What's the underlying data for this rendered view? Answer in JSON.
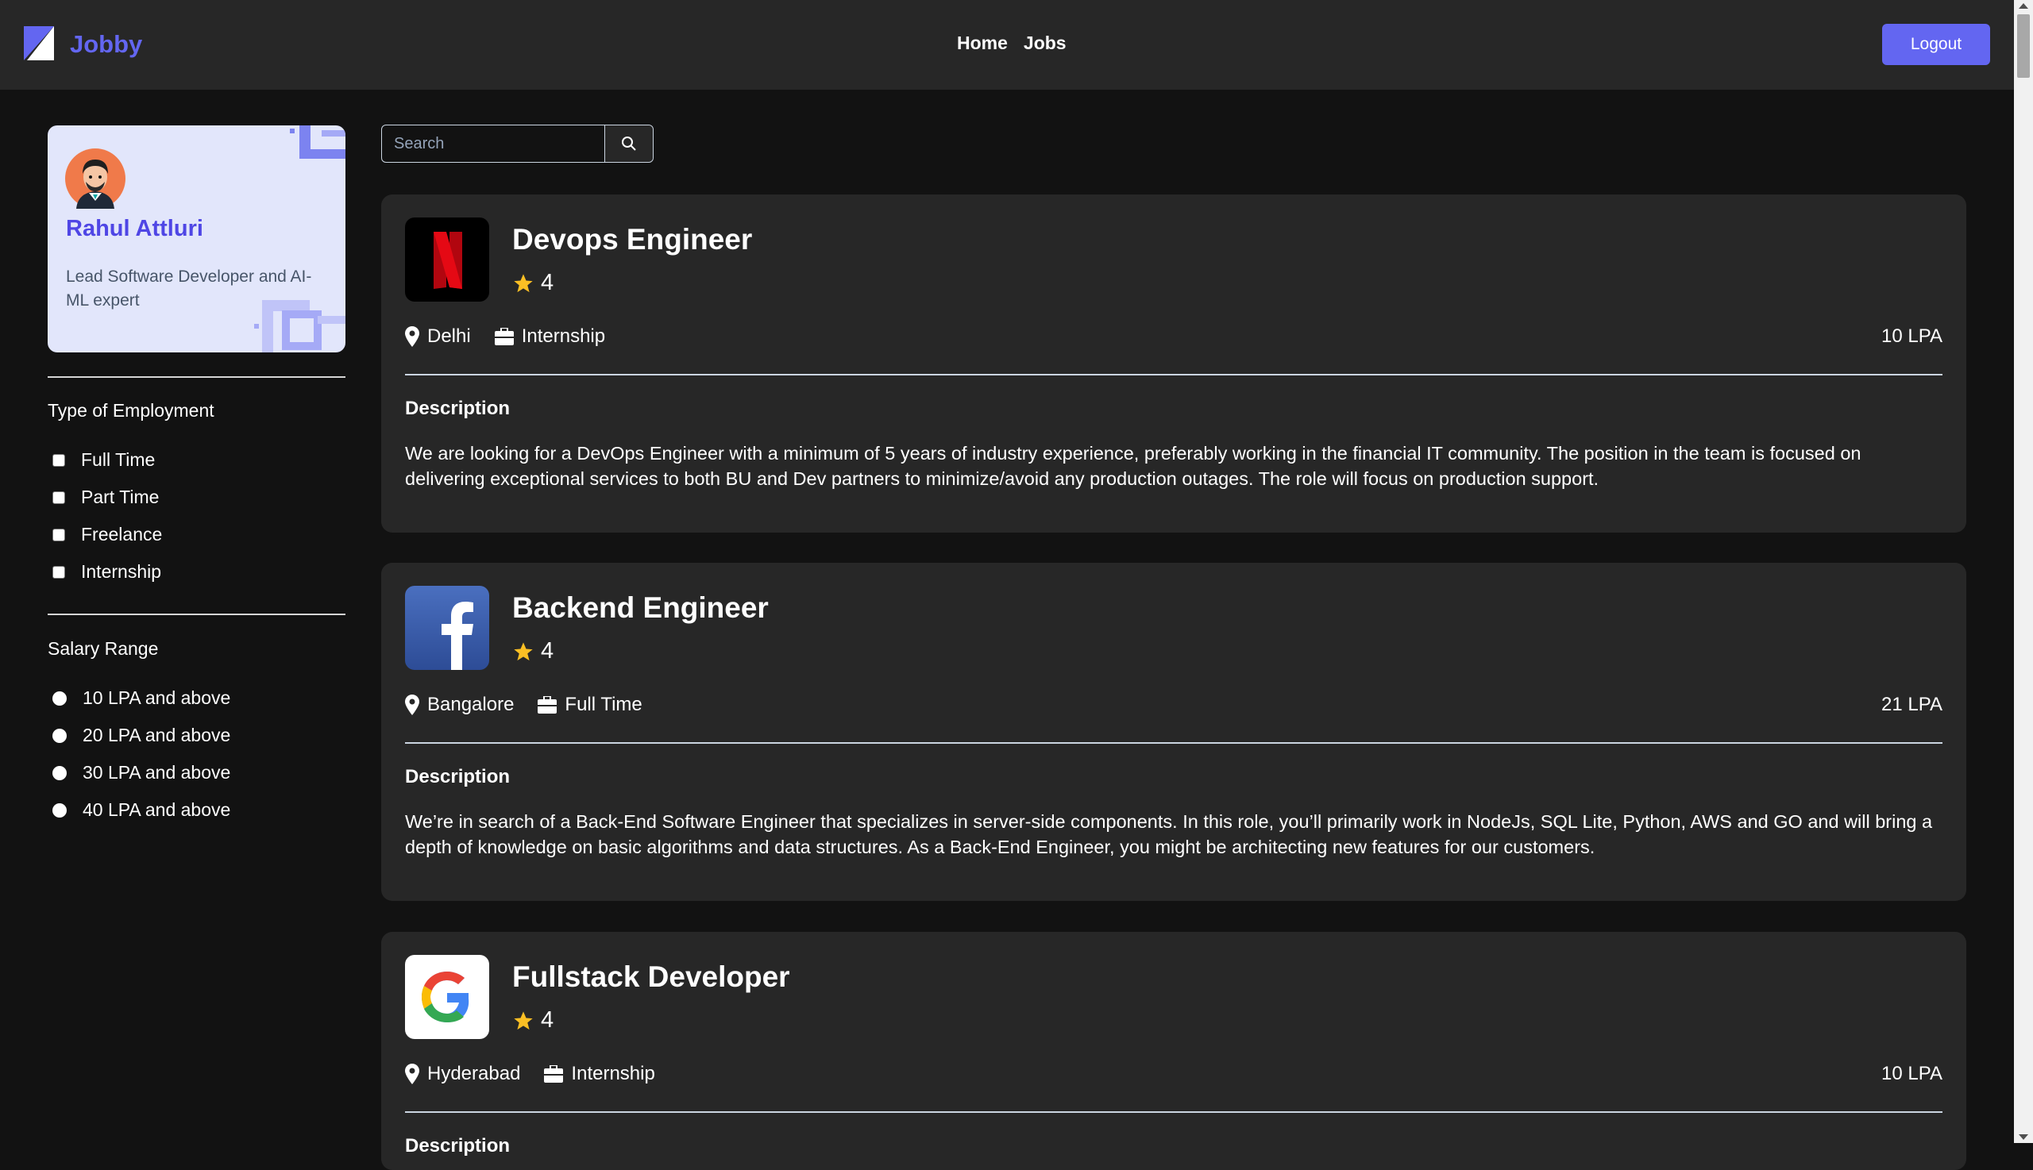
{
  "header": {
    "brand": "Jobby",
    "nav": [
      "Home",
      "Jobs"
    ],
    "logout_label": "Logout"
  },
  "profile": {
    "name": "Rahul Attluri",
    "bio": "Lead Software Developer and AI-ML expert"
  },
  "filters": {
    "employment_title": "Type of Employment",
    "employment_options": [
      "Full Time",
      "Part Time",
      "Freelance",
      "Internship"
    ],
    "salary_title": "Salary Range",
    "salary_options": [
      "10 LPA and above",
      "20 LPA and above",
      "30 LPA and above",
      "40 LPA and above"
    ]
  },
  "search": {
    "placeholder": "Search"
  },
  "jobs": [
    {
      "title": "Devops Engineer",
      "rating": "4",
      "location": "Delhi",
      "employment_type": "Internship",
      "package": "10 LPA",
      "description_heading": "Description",
      "description": "We are looking for a DevOps Engineer with a minimum of 5 years of industry experience, preferably working in the financial IT community. The position in the team is focused on delivering exceptional services to both BU and Dev partners to minimize/avoid any production outages. The role will focus on production support.",
      "company_logo": "netflix-logo"
    },
    {
      "title": "Backend Engineer",
      "rating": "4",
      "location": "Bangalore",
      "employment_type": "Full Time",
      "package": "21 LPA",
      "description_heading": "Description",
      "description": "We’re in search of a Back-End Software Engineer that specializes in server-side components. In this role, you’ll primarily work in NodeJs, SQL Lite, Python, AWS and GO and will bring a depth of knowledge on basic algorithms and data structures. As a Back-End Engineer, you might be architecting new features for our customers.",
      "company_logo": "facebook-logo"
    },
    {
      "title": "Fullstack Developer",
      "rating": "4",
      "location": "Hyderabad",
      "employment_type": "Internship",
      "package": "10 LPA",
      "description_heading": "Description",
      "company_logo": "google-logo"
    }
  ],
  "colors": {
    "accent": "#6366f1",
    "background": "#121212",
    "card": "#272727",
    "star": "#fbbf24"
  }
}
